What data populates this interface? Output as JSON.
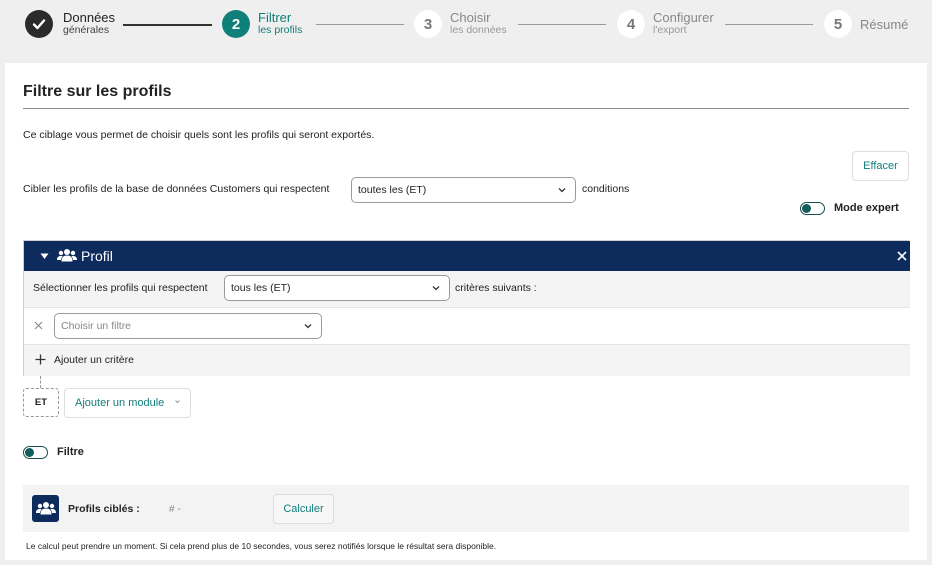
{
  "stepper": {
    "steps": [
      {
        "number": "",
        "title": "Données",
        "subtitle": "générales",
        "state": "done"
      },
      {
        "number": "2",
        "title": "Filtrer",
        "subtitle": "les profils",
        "state": "active"
      },
      {
        "number": "3",
        "title": "Choisir",
        "subtitle": "les données",
        "state": "todo"
      },
      {
        "number": "4",
        "title": "Configurer",
        "subtitle": "l'export",
        "state": "todo"
      },
      {
        "number": "5",
        "title": "Résumé",
        "subtitle": "",
        "state": "todo"
      }
    ]
  },
  "page": {
    "title": "Filtre sur les profils",
    "description": "Ce ciblage vous permet de choisir quels sont les profils qui seront exportés.",
    "clear_button": "Effacer",
    "target_prefix": "Cibler les profils de la base de données Customers qui respectent",
    "target_select": "toutes les (ET)",
    "target_suffix": "conditions",
    "expert_mode_label": "Mode expert"
  },
  "module": {
    "title": "Profil",
    "select_prefix": "Sélectionner les profils qui respectent",
    "select_value": "tous les (ET)",
    "select_suffix": "critères suivants :",
    "filter_placeholder": "Choisir un filtre",
    "add_criterion": "Ajouter un critère"
  },
  "operator": {
    "label": "ET",
    "add_module": "Ajouter un module"
  },
  "filter_toggle_label": "Filtre",
  "calc": {
    "label": "Profils ciblés :",
    "value": "# -",
    "button": "Calculer",
    "note": "Le calcul peut prendre un moment. Si cela prend plus de 10 secondes, vous serez notifiés lorsque le résultat sera disponible."
  },
  "colors": {
    "accent": "#0f7f7a",
    "module_header": "#0d2b5c"
  }
}
